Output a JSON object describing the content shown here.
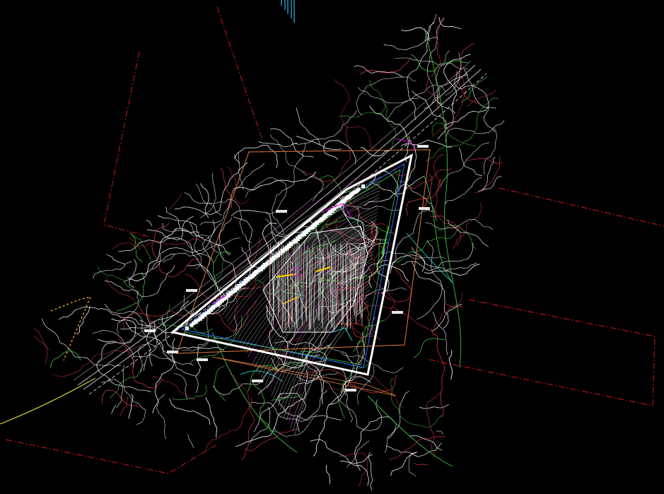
{
  "drawing": {
    "background": "#000000",
    "colors": {
      "contour_white": "#e8e8e8",
      "contour_red": "#c0303a",
      "contour_green": "#3fbf3f",
      "contour_cyan": "#27c9c9",
      "boundary_red": "#d01818",
      "boundary_orange": "#e07a3a",
      "road_gray": "#bdbdbd",
      "road_yellow": "#f2e93a",
      "site_white": "#ffffff",
      "accent_magenta": "#e000e0",
      "accent_yellow": "#ffd400",
      "accent_blue": "#2f6bff",
      "accent_cyan_top": "#29b6e6",
      "tag_fill": "#e6e6e6"
    }
  }
}
